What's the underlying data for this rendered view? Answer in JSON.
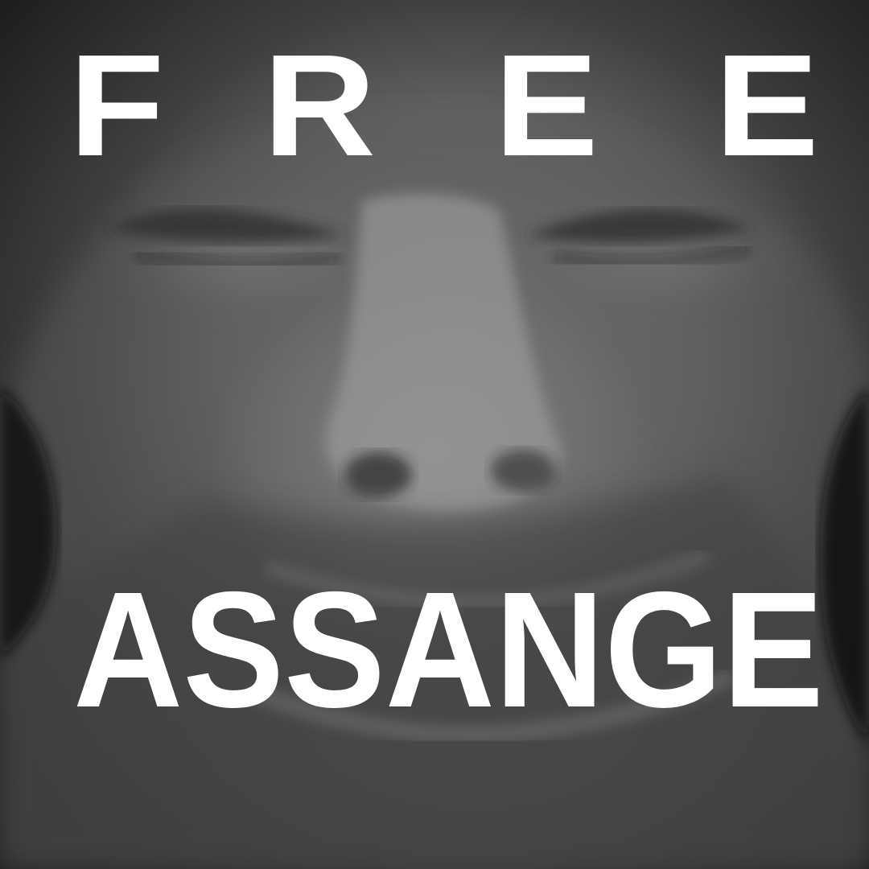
{
  "poster": {
    "top_letters": [
      "F",
      "R",
      "E",
      "E"
    ],
    "bottom_word": "ASSANGE"
  }
}
